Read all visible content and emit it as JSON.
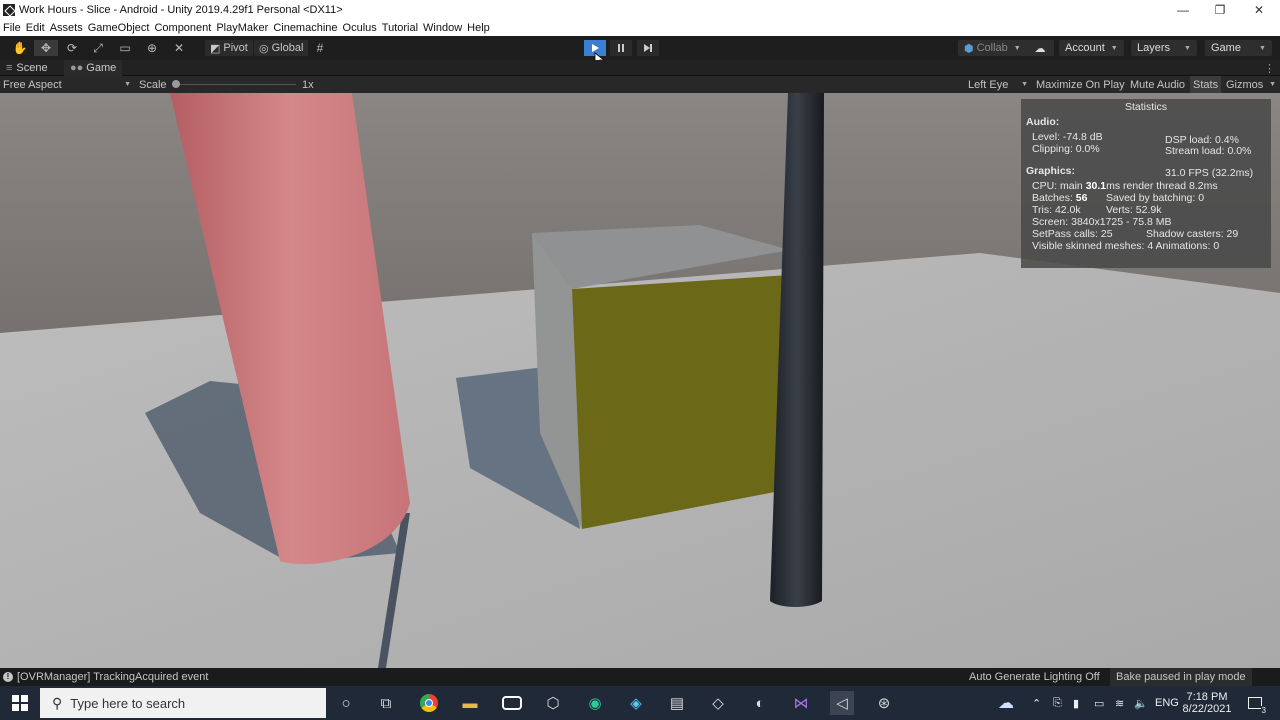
{
  "window": {
    "title": "Work Hours - Slice - Android - Unity 2019.4.29f1 Personal <DX11>",
    "controls": {
      "minimize": "—",
      "maximize": "❐",
      "close": "✕"
    }
  },
  "menu": [
    "File",
    "Edit",
    "Assets",
    "GameObject",
    "Component",
    "PlayMaker",
    "Cinemachine",
    "Oculus",
    "Tutorial",
    "Window",
    "Help"
  ],
  "toolbar": {
    "pivot_label": "Pivot",
    "global_label": "Global",
    "collab_label": "Collab",
    "account_label": "Account",
    "layers_label": "Layers",
    "layout_label": "Game",
    "accent_play": "#3a7fd0"
  },
  "tabs": {
    "scene": "Scene",
    "game": "Game"
  },
  "gamebar": {
    "aspect": "Free Aspect",
    "scale_label": "Scale",
    "scale_value": "1x",
    "eye": "Left Eye",
    "maximize": "Maximize On Play",
    "mute": "Mute Audio",
    "stats": "Stats",
    "gizmos": "Gizmos"
  },
  "stats": {
    "heading": "Statistics",
    "audio_label": "Audio:",
    "level": "Level: -74.8 dB",
    "clipping": "Clipping: 0.0%",
    "dsp": "DSP load: 0.4%",
    "stream": "Stream load: 0.0%",
    "graphics_label": "Graphics:",
    "fps": "31.0 FPS (32.2ms)",
    "cpu_prefix": "CPU: main ",
    "cpu_main": "30.1",
    "cpu_suffix": "ms  render thread 8.2ms",
    "batches_prefix": "Batches: ",
    "batches": "56",
    "saved": "Saved by batching: 0",
    "tris": "Tris: 42.0k",
    "verts": "Verts: 52.9k",
    "screen": "Screen: 3840x1725 - 75.8 MB",
    "setpass": "SetPass calls: 25",
    "shadow": "Shadow casters: 29",
    "skinned": "Visible skinned meshes: 4  Animations: 0"
  },
  "status": {
    "message": "[OVRManager] TrackingAcquired event",
    "lighting": "Auto Generate Lighting Off",
    "bake": "Bake paused in play mode"
  },
  "taskbar": {
    "search_placeholder": "Type here to search",
    "lang": "ENG",
    "time": "7:18 PM",
    "date": "8/22/2021",
    "notifications": "3"
  }
}
